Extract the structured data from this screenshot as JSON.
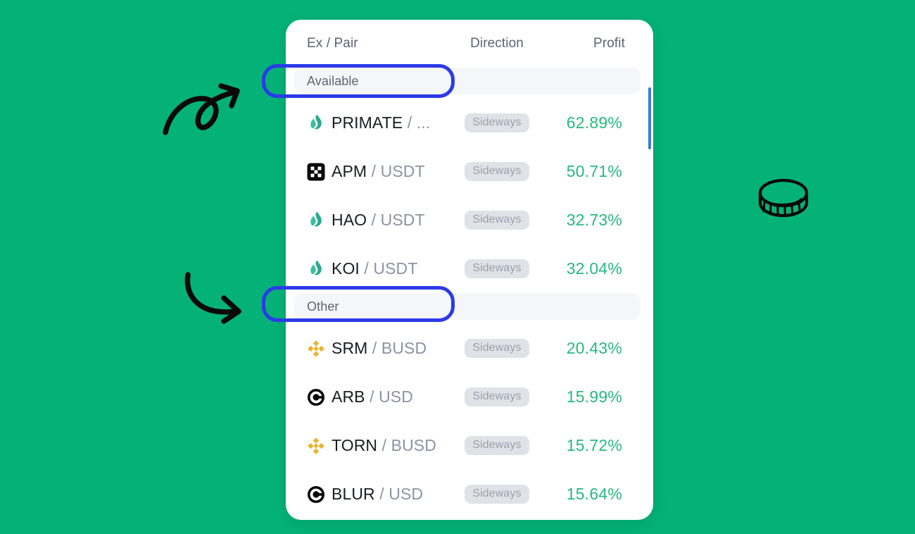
{
  "theme": {
    "background": "#04b277",
    "card_background": "#ffffff",
    "profit_color": "#27b97d",
    "annotation_color": "#2c3ae8",
    "scrollbar_color": "#3b7ddd",
    "badge_background": "#e0e2e7",
    "section_background": "#f5f6f8"
  },
  "table": {
    "columns": {
      "pair": "Ex / Pair",
      "direction": "Direction",
      "profit": "Profit"
    },
    "sections": [
      {
        "label": "Available",
        "rows": [
          {
            "icon": "gate-flame-icon",
            "base": "PRIMATE",
            "separator": " / ",
            "quote": "...",
            "direction": "Sideways",
            "profit": "62.89%"
          },
          {
            "icon": "apm-squares-icon",
            "base": "APM",
            "separator": " / ",
            "quote": "USDT",
            "direction": "Sideways",
            "profit": "50.71%"
          },
          {
            "icon": "gate-flame-icon",
            "base": "HAO",
            "separator": " / ",
            "quote": "USDT",
            "direction": "Sideways",
            "profit": "32.73%"
          },
          {
            "icon": "gate-flame-icon",
            "base": "KOI",
            "separator": " / ",
            "quote": "USDT",
            "direction": "Sideways",
            "profit": "32.04%"
          }
        ]
      },
      {
        "label": "Other",
        "rows": [
          {
            "icon": "binance-diamond-icon",
            "base": "SRM",
            "separator": " / ",
            "quote": "BUSD",
            "direction": "Sideways",
            "profit": "20.43%"
          },
          {
            "icon": "coinbase-circle-icon",
            "base": "ARB",
            "separator": " / ",
            "quote": "USD",
            "direction": "Sideways",
            "profit": "15.99%"
          },
          {
            "icon": "binance-diamond-icon",
            "base": "TORN",
            "separator": " / ",
            "quote": "BUSD",
            "direction": "Sideways",
            "profit": "15.72%"
          },
          {
            "icon": "coinbase-circle-icon",
            "base": "BLUR",
            "separator": " / ",
            "quote": "USD",
            "direction": "Sideways",
            "profit": "15.64%"
          }
        ]
      }
    ]
  },
  "annotations": {
    "highlight_available": "Available",
    "highlight_other": "Other",
    "doodles": [
      "loop-arrow-doodle",
      "curve-arrow-doodle",
      "coin-doodle"
    ]
  }
}
